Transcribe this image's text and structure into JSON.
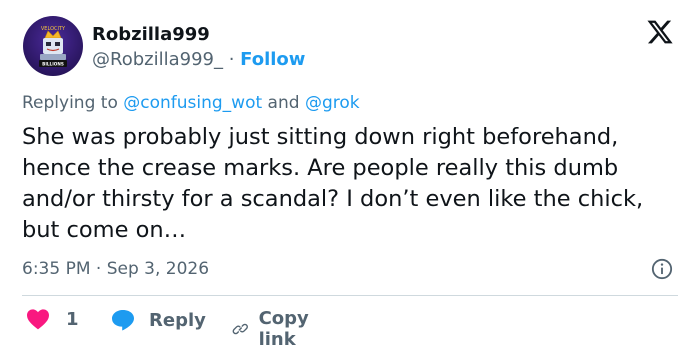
{
  "user": {
    "display_name": "Robzilla999",
    "handle": "@Robzilla999_",
    "separator": " · ",
    "follow_label": "Follow",
    "avatar_badge_text": "BILLIONS",
    "avatar_top_text": "VELOCITY"
  },
  "reply_context": {
    "prefix": "Replying to ",
    "mention_1": "@confusing_wot",
    "and": " and ",
    "mention_2": "@grok"
  },
  "tweet": {
    "text": "She was probably just sitting down right beforehand, hence the crease marks. Are people really this dumb and/or thirsty for a scandal? I don’t even like the chick, but come on…",
    "time": "6:35 PM",
    "date_separator": " · ",
    "date": "Sep 3, 2026"
  },
  "actions": {
    "like_count": "1",
    "reply_label": "Reply",
    "copy_label": "Copy link"
  },
  "colors": {
    "text": "#0f1419",
    "muted": "#536471",
    "accent": "#1d9bf0",
    "like": "#f91880",
    "divider": "#cfd9de"
  },
  "icons": [
    "x-logo-icon",
    "info-icon",
    "heart-icon",
    "reply-bubble-icon",
    "link-icon"
  ]
}
